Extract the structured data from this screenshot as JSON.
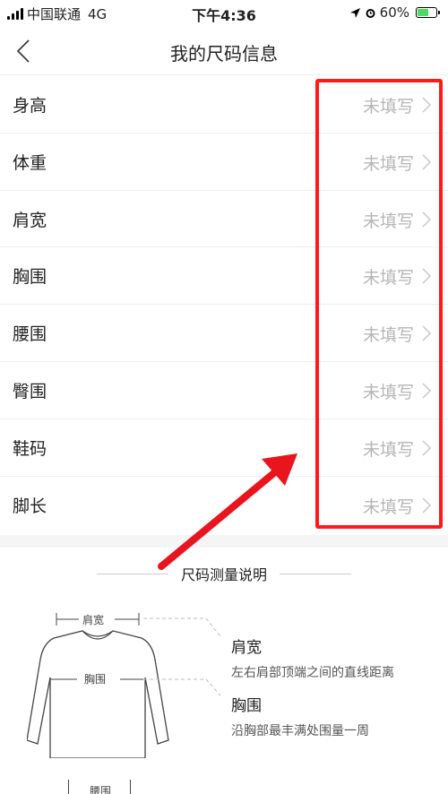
{
  "status_bar": {
    "carrier": "中国联通",
    "network": "4G",
    "time": "下午4:36",
    "battery": "60%",
    "battery_level": 0.6
  },
  "nav": {
    "title": "我的尺码信息"
  },
  "rows": [
    {
      "label": "身高",
      "value": "未填写"
    },
    {
      "label": "体重",
      "value": "未填写"
    },
    {
      "label": "肩宽",
      "value": "未填写"
    },
    {
      "label": "胸围",
      "value": "未填写"
    },
    {
      "label": "腰围",
      "value": "未填写"
    },
    {
      "label": "臀围",
      "value": "未填写"
    },
    {
      "label": "鞋码",
      "value": "未填写"
    },
    {
      "label": "脚长",
      "value": "未填写"
    }
  ],
  "guide": {
    "title": "尺码测量说明",
    "shirt_shoulder_label": "肩宽",
    "shirt_chest_label": "胸围",
    "items": [
      {
        "title": "肩宽",
        "desc": "左右肩部顶端之间的直线距离"
      },
      {
        "title": "胸围",
        "desc": "沿胸部最丰满处围量一周"
      }
    ],
    "pants_waist_label": "腰围"
  },
  "colors": {
    "highlight": "#ff1a1a",
    "value_text": "#b5b5b5",
    "battery": "#4cd964"
  }
}
